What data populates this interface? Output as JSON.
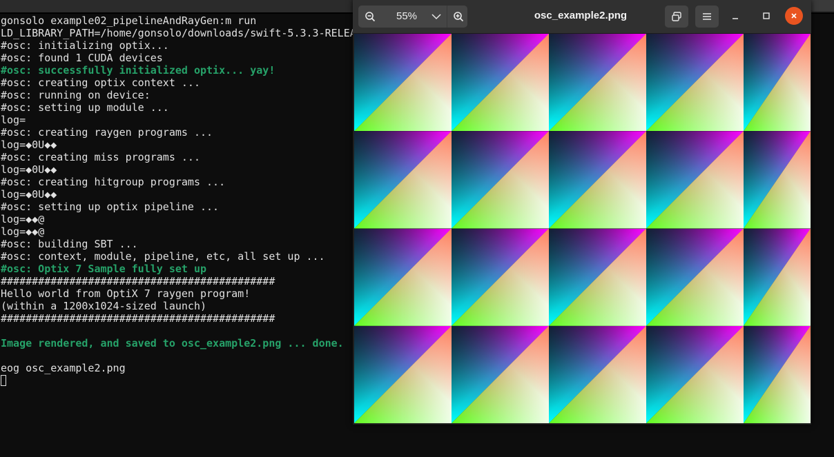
{
  "terminal": {
    "lines": [
      {
        "text": "gonsolo example02_pipelineAndRayGen:m run",
        "style": "normal"
      },
      {
        "text": "LD_LIBRARY_PATH=/home/gonsolo/downloads/swift-5.3.3-RELEA",
        "style": "normal"
      },
      {
        "text": "#osc: initializing optix...",
        "style": "normal"
      },
      {
        "text": "#osc: found 1 CUDA devices",
        "style": "normal"
      },
      {
        "text": "#osc: successfully initialized optix... yay!",
        "style": "green"
      },
      {
        "text": "#osc: creating optix context ...",
        "style": "normal"
      },
      {
        "text": "#osc: running on device:",
        "style": "normal"
      },
      {
        "text": "#osc: setting up module ...",
        "style": "normal"
      },
      {
        "text": "log=",
        "style": "normal"
      },
      {
        "text": "#osc: creating raygen programs ...",
        "style": "normal"
      },
      {
        "text": "log=◆0U◆◆",
        "style": "normal"
      },
      {
        "text": "#osc: creating miss programs ...",
        "style": "normal"
      },
      {
        "text": "log=◆0U◆◆",
        "style": "normal"
      },
      {
        "text": "#osc: creating hitgroup programs ...",
        "style": "normal"
      },
      {
        "text": "log=◆0U◆◆",
        "style": "normal"
      },
      {
        "text": "#osc: setting up optix pipeline ...",
        "style": "normal"
      },
      {
        "text": "log=◆◆@",
        "style": "normal"
      },
      {
        "text": "log=◆◆@",
        "style": "normal"
      },
      {
        "text": "#osc: building SBT ...",
        "style": "normal"
      },
      {
        "text": "#osc: context, module, pipeline, etc, all set up ...",
        "style": "normal"
      },
      {
        "text": "#osc: Optix 7 Sample fully set up",
        "style": "green"
      },
      {
        "text": "############################################",
        "style": "normal"
      },
      {
        "text": "Hello world from OptiX 7 raygen program!",
        "style": "normal"
      },
      {
        "text": "(within a 1200x1024-sized launch)",
        "style": "normal"
      },
      {
        "text": "############################################",
        "style": "normal"
      },
      {
        "text": "",
        "style": "normal"
      },
      {
        "text": "Image rendered, and saved to osc_example2.png ... done.",
        "style": "green"
      },
      {
        "text": "",
        "style": "normal"
      },
      {
        "text": "eog osc_example2.png",
        "style": "normal"
      }
    ],
    "colors": {
      "text": "#e0e0e0",
      "green": "#26a269",
      "background": "#0d0d0d"
    }
  },
  "viewer": {
    "zoom_level": "55%",
    "title": "osc_example2.png",
    "icons": {
      "zoom_out": "zoom-out-icon",
      "zoom_dropdown": "chevron-down-icon",
      "zoom_in": "zoom-in-icon",
      "gallery": "gallery-icon",
      "menu": "hamburger-menu-icon",
      "minimize": "minimize-icon",
      "maximize": "maximize-icon",
      "close": "close-icon"
    },
    "colors": {
      "header": "#303030",
      "close_button": "#e95420"
    },
    "image_grid": {
      "rows": 4,
      "cols": 5
    }
  }
}
